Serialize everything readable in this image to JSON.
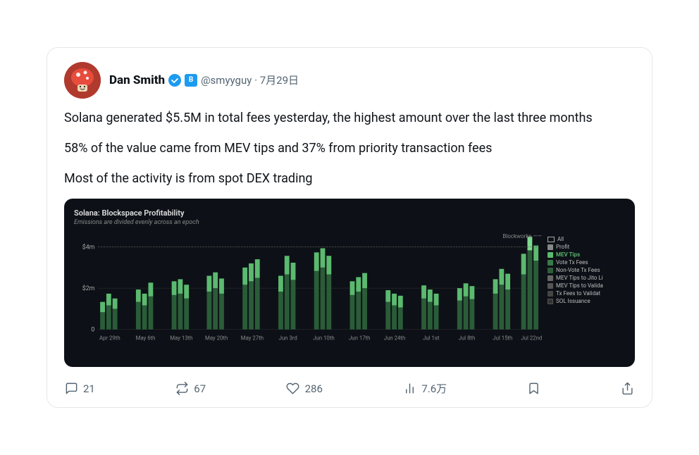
{
  "tweet": {
    "display_name": "Dan Smith",
    "username": "@smyyguy",
    "date": "7月29日",
    "text_1": "Solana generated $5.5M in total fees yesterday, the highest amount over the last three months",
    "text_2": "58% of the value came from MEV tips and 37% from priority transaction fees",
    "text_3": "Most of the activity is from spot DEX trading",
    "actions": {
      "comments": "21",
      "retweets": "67",
      "likes": "286",
      "views": "7.6万"
    }
  },
  "chart": {
    "title": "Solana: Blockspace Profitability",
    "subtitle": "Emissions are divided evenly across an epoch",
    "source": "Blockworks",
    "y_labels": [
      "$4m",
      "$2m",
      "0"
    ],
    "x_labels": [
      "Apr 29th",
      "May 6th",
      "May 13th",
      "May 20th",
      "May 27th",
      "Jun 3rd",
      "Jun 10th",
      "Jun 17th",
      "Jun 24th",
      "Jul 1st",
      "Jul 8th",
      "Jul 15th",
      "Jul 22nd"
    ],
    "legend": [
      {
        "label": "All",
        "color": "#ccc"
      },
      {
        "label": "Profit",
        "color": "#888"
      },
      {
        "label": "MEV Tips",
        "color": "#5bba6f"
      },
      {
        "label": "Vote Tx Fees",
        "color": "#3a7a48"
      },
      {
        "label": "Non-Vote Tx Fees",
        "color": "#2d5e38"
      },
      {
        "label": "MEV Tips to Jito Li",
        "color": "#666"
      },
      {
        "label": "MEV Tips to Valida",
        "color": "#555"
      },
      {
        "label": "Tx Fees to Validat",
        "color": "#444"
      },
      {
        "label": "SOL Issuance",
        "color": "#333"
      }
    ]
  },
  "icons": {
    "comment": "💬",
    "retweet": "🔁",
    "like": "♡",
    "views": "📊",
    "bookmark": "🔖",
    "share": "⬆"
  }
}
